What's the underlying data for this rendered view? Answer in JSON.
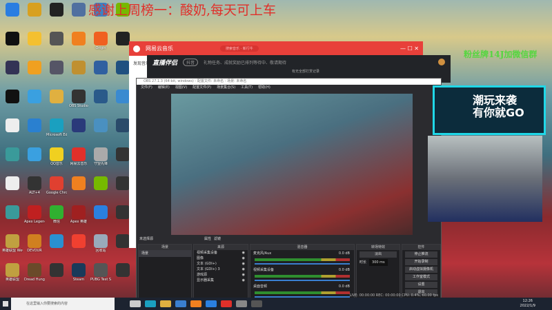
{
  "banner_text": "感谢上周榜一：酸奶,每天可上车",
  "fans_text": "粉丝牌14J加微信群",
  "desktop_icons": [
    {
      "label": "",
      "color": "#2a7de1"
    },
    {
      "label": "",
      "color": "#d8a020"
    },
    {
      "label": "",
      "color": "#222"
    },
    {
      "label": "",
      "color": "#5070a0"
    },
    {
      "label": "",
      "color": "#4080c0"
    },
    {
      "label": "",
      "color": "#76b900"
    },
    {
      "label": "",
      "color": "#111"
    },
    {
      "label": "",
      "color": "#f4c030"
    },
    {
      "label": "",
      "color": "#555"
    },
    {
      "label": "",
      "color": "#f08020"
    },
    {
      "label": "Origin",
      "color": "#f06020"
    },
    {
      "label": "",
      "color": "#222"
    },
    {
      "label": "",
      "color": "#335"
    },
    {
      "label": "",
      "color": "#f0a020"
    },
    {
      "label": "",
      "color": "#556"
    },
    {
      "label": "",
      "color": "#c09030"
    },
    {
      "label": "",
      "color": "#3060a0"
    },
    {
      "label": "",
      "color": "#205080"
    },
    {
      "label": "",
      "color": "#111"
    },
    {
      "label": "",
      "color": "#3aa0e0"
    },
    {
      "label": "",
      "color": "#e0b040"
    },
    {
      "label": "OBS Studio",
      "color": "#333"
    },
    {
      "label": "",
      "color": "#2a5a8a"
    },
    {
      "label": "",
      "color": "#3a8ad0"
    },
    {
      "label": "",
      "color": "#eee"
    },
    {
      "label": "",
      "color": "#2a80d0"
    },
    {
      "label": "Microsoft Edge",
      "color": "#1aa0c0"
    },
    {
      "label": "",
      "color": "#2a3a7a"
    },
    {
      "label": "",
      "color": "#4a90c0"
    },
    {
      "label": "",
      "color": "#2a4a6a"
    },
    {
      "label": "",
      "color": "#3a9a9a"
    },
    {
      "label": "",
      "color": "#3aa0e0"
    },
    {
      "label": "QQ音乐",
      "color": "#f0d020"
    },
    {
      "label": "网易云音乐",
      "color": "#e0302a"
    },
    {
      "label": "守望先锋",
      "color": "#aaa"
    },
    {
      "label": "",
      "color": "#333"
    },
    {
      "label": "",
      "color": "#eee"
    },
    {
      "label": "ALT+4",
      "color": "#333"
    },
    {
      "label": "Google Chrome",
      "color": "#e04030"
    },
    {
      "label": "",
      "color": "#f08020"
    },
    {
      "label": "",
      "color": "#76b900"
    },
    {
      "label": "",
      "color": "#333"
    },
    {
      "label": "",
      "color": "#3a9a9a"
    },
    {
      "label": "Apex Legends",
      "color": "#c02020"
    },
    {
      "label": "微信",
      "color": "#30b030"
    },
    {
      "label": "Apex 英雄",
      "color": "#a02020"
    },
    {
      "label": "",
      "color": "#2a80e0"
    },
    {
      "label": "",
      "color": "#333"
    },
    {
      "label": "英雄联盟 WeGame版",
      "color": "#c0a040"
    },
    {
      "label": "DEVOUR",
      "color": "#d08020"
    },
    {
      "label": "",
      "color": "#2a90d0"
    },
    {
      "label": "",
      "color": "#f04030"
    },
    {
      "label": "回收站",
      "color": "#9ab"
    },
    {
      "label": "",
      "color": "#333"
    },
    {
      "label": "英雄联盟",
      "color": "#c0a040"
    },
    {
      "label": "Dread Hunger",
      "color": "#6a4a2a"
    },
    {
      "label": "",
      "color": "#333"
    },
    {
      "label": "Steam",
      "color": "#1a3a5a"
    },
    {
      "label": "PUBG Test Server",
      "color": "#555"
    },
    {
      "label": "",
      "color": "#333"
    }
  ],
  "netease": {
    "title": "网易云音乐",
    "search": "搜索音乐 · 新行牛",
    "sidebar": "发现音乐"
  },
  "zhibo": {
    "title": "直播伴侣",
    "badge": "抖音",
    "notice": "礼物任务、成就奖励已排列等待中、敬请期待",
    "tab": "有无全部打赏记录"
  },
  "obs": {
    "title": "OBS 27.1.3 (64-bit, windows) - 配置文件: 未命名 - 场景: 未命名",
    "menu": [
      "文件(F)",
      "编辑(E)",
      "视图(V)",
      "配置文件(P)",
      "场景集合(S)",
      "工具(T)",
      "帮助(H)"
    ],
    "no_source": "未选择源",
    "props": "属性",
    "filters": "滤镜",
    "docks": {
      "scenes": "场景",
      "sources": "来源",
      "mixer": "混音器",
      "transitions": "转场特效",
      "controls": "控件"
    },
    "scenes": [
      "场景"
    ],
    "sources": [
      "视频采集设备",
      "图像",
      "文本 (GDI+)",
      "文本 (GDI+) 3",
      "游戏源",
      "显示器采集"
    ],
    "mixer": [
      {
        "name": "麦克风/Aux",
        "db": "0.0 dB"
      },
      {
        "name": "视频采集设备",
        "db": "0.0 dB"
      },
      {
        "name": "桌面音频",
        "db": "0.0 dB"
      }
    ],
    "transition": "淡出",
    "duration_label": "时长",
    "duration": "300 ms",
    "controls": [
      "停止推流",
      "开始录制",
      "启动虚拟摄像机",
      "工作室模式",
      "设置",
      "退出"
    ],
    "status": "LIVE: 00:00:00   REC: 00:00:00   CPU: 0.4%, 60.00 fps"
  },
  "taskbar": {
    "search_placeholder": "在这里输入你要搜索的内容",
    "time": "12:26",
    "date": "2022/1/9"
  }
}
